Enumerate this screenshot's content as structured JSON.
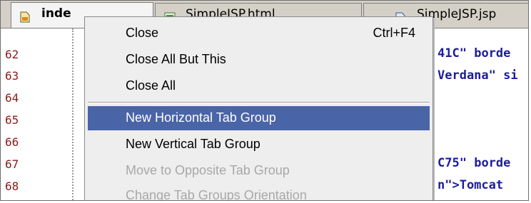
{
  "tabs": [
    {
      "label": "index.jsp",
      "visible_label": "inde",
      "icon": "jsp-file-icon",
      "active": true
    },
    {
      "label": "SimpleJSP.html",
      "visible_label": "SimpleJSP.html",
      "icon": "html-file-icon",
      "active": false
    },
    {
      "label": "SimpleJSP.jsp",
      "visible_label": "SimpleJSP.jsp",
      "icon": "file-icon",
      "active": false
    }
  ],
  "line_numbers": [
    "62",
    "63",
    "64",
    "65",
    "66",
    "67",
    "68"
  ],
  "code_fragments": [
    {
      "line": "62",
      "text": "41C\"",
      "kw": "borde"
    },
    {
      "line": "63",
      "text": "Verdana\"",
      "kw": "si"
    },
    {
      "line": "64",
      "text": "",
      "kw": ""
    },
    {
      "line": "65",
      "text": "",
      "kw": ""
    },
    {
      "line": "66",
      "text": "",
      "kw": ""
    },
    {
      "line": "67",
      "text": "C75\"",
      "kw": "borde"
    },
    {
      "line": "68",
      "text": "n\">Tomcat",
      "kw": ""
    }
  ],
  "context_menu": {
    "items": [
      {
        "label": "Close",
        "shortcut": "Ctrl+F4",
        "state": "normal"
      },
      {
        "label": "Close All But This",
        "shortcut": "",
        "state": "normal"
      },
      {
        "label": "Close All",
        "shortcut": "",
        "state": "normal"
      },
      {
        "label": "New Horizontal Tab Group",
        "shortcut": "",
        "state": "selected"
      },
      {
        "label": "New Vertical Tab Group",
        "shortcut": "",
        "state": "normal"
      },
      {
        "label": "Move to Opposite Tab Group",
        "shortcut": "",
        "state": "disabled"
      },
      {
        "label": "Change Tab Groups Orientation",
        "shortcut": "",
        "state": "disabled"
      }
    ]
  },
  "colors": {
    "menu_highlight": "#4a64a8",
    "line_number": "#8b1a1a",
    "keyword": "#1c1c9c",
    "disabled_text": "#a8a8a8"
  }
}
